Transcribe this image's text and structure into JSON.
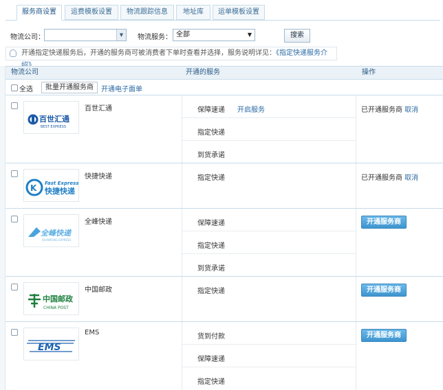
{
  "tabs": [
    "服务商设置",
    "运费模板设置",
    "物流跟踪信息",
    "地址库",
    "运单模板设置"
  ],
  "filter": {
    "company_label": "物流公司：",
    "company_value": "",
    "service_label": "物流服务：",
    "service_value": "全部",
    "search_label": "搜索"
  },
  "notice": {
    "text": "开通指定快递服务后，开通的服务商可被消费者下单时查看并选择，服务说明详见：",
    "link": "《指定快递服务介绍》"
  },
  "table": {
    "headers": [
      "物流公司",
      "开通的服务",
      "操作"
    ],
    "select_all": "全选",
    "bulk_button": "批量开通服务商",
    "bulk_link": "开通电子面单"
  },
  "carriers": [
    {
      "name": "百世汇通",
      "logo_title": "百世汇通",
      "logo_sub": "BEST EXPRESS",
      "services": [
        {
          "name": "保障速递",
          "open": "开启服务"
        },
        {
          "name": "指定快递",
          "open": ""
        },
        {
          "name": "到货承诺",
          "open": ""
        }
      ],
      "status": "已开通服务商",
      "cancel": "取消",
      "button": ""
    },
    {
      "name": "快捷快递",
      "logo_title": "快捷快递",
      "logo_sub": "Fast Express",
      "services": [
        {
          "name": "指定快递",
          "open": ""
        }
      ],
      "status": "已开通服务商",
      "cancel": "取消",
      "button": ""
    },
    {
      "name": "全峰快递",
      "logo_title": "全峰快递",
      "logo_sub": "QUANFENG EXPRESS",
      "services": [
        {
          "name": "保障速递",
          "open": ""
        },
        {
          "name": "指定快递",
          "open": ""
        },
        {
          "name": "到货承诺",
          "open": ""
        }
      ],
      "status": "",
      "cancel": "",
      "button": "开通服务商"
    },
    {
      "name": "中国邮政",
      "logo_title": "中国邮政",
      "logo_sub": "CHINA POST",
      "services": [
        {
          "name": "指定快递",
          "open": ""
        }
      ],
      "status": "",
      "cancel": "",
      "button": "开通服务商"
    },
    {
      "name": "EMS",
      "logo_title": "EMS",
      "logo_sub": "",
      "services": [
        {
          "name": "货到付款",
          "open": ""
        },
        {
          "name": "保障速递",
          "open": ""
        },
        {
          "name": "指定快递",
          "open": ""
        }
      ],
      "status": "",
      "cancel": "",
      "button": "开通服务商"
    }
  ],
  "colors": {
    "accent": "#3d95cf",
    "link": "#2b6aa4",
    "header_bg": "#eaf2f8",
    "border": "#c7dbe9"
  }
}
